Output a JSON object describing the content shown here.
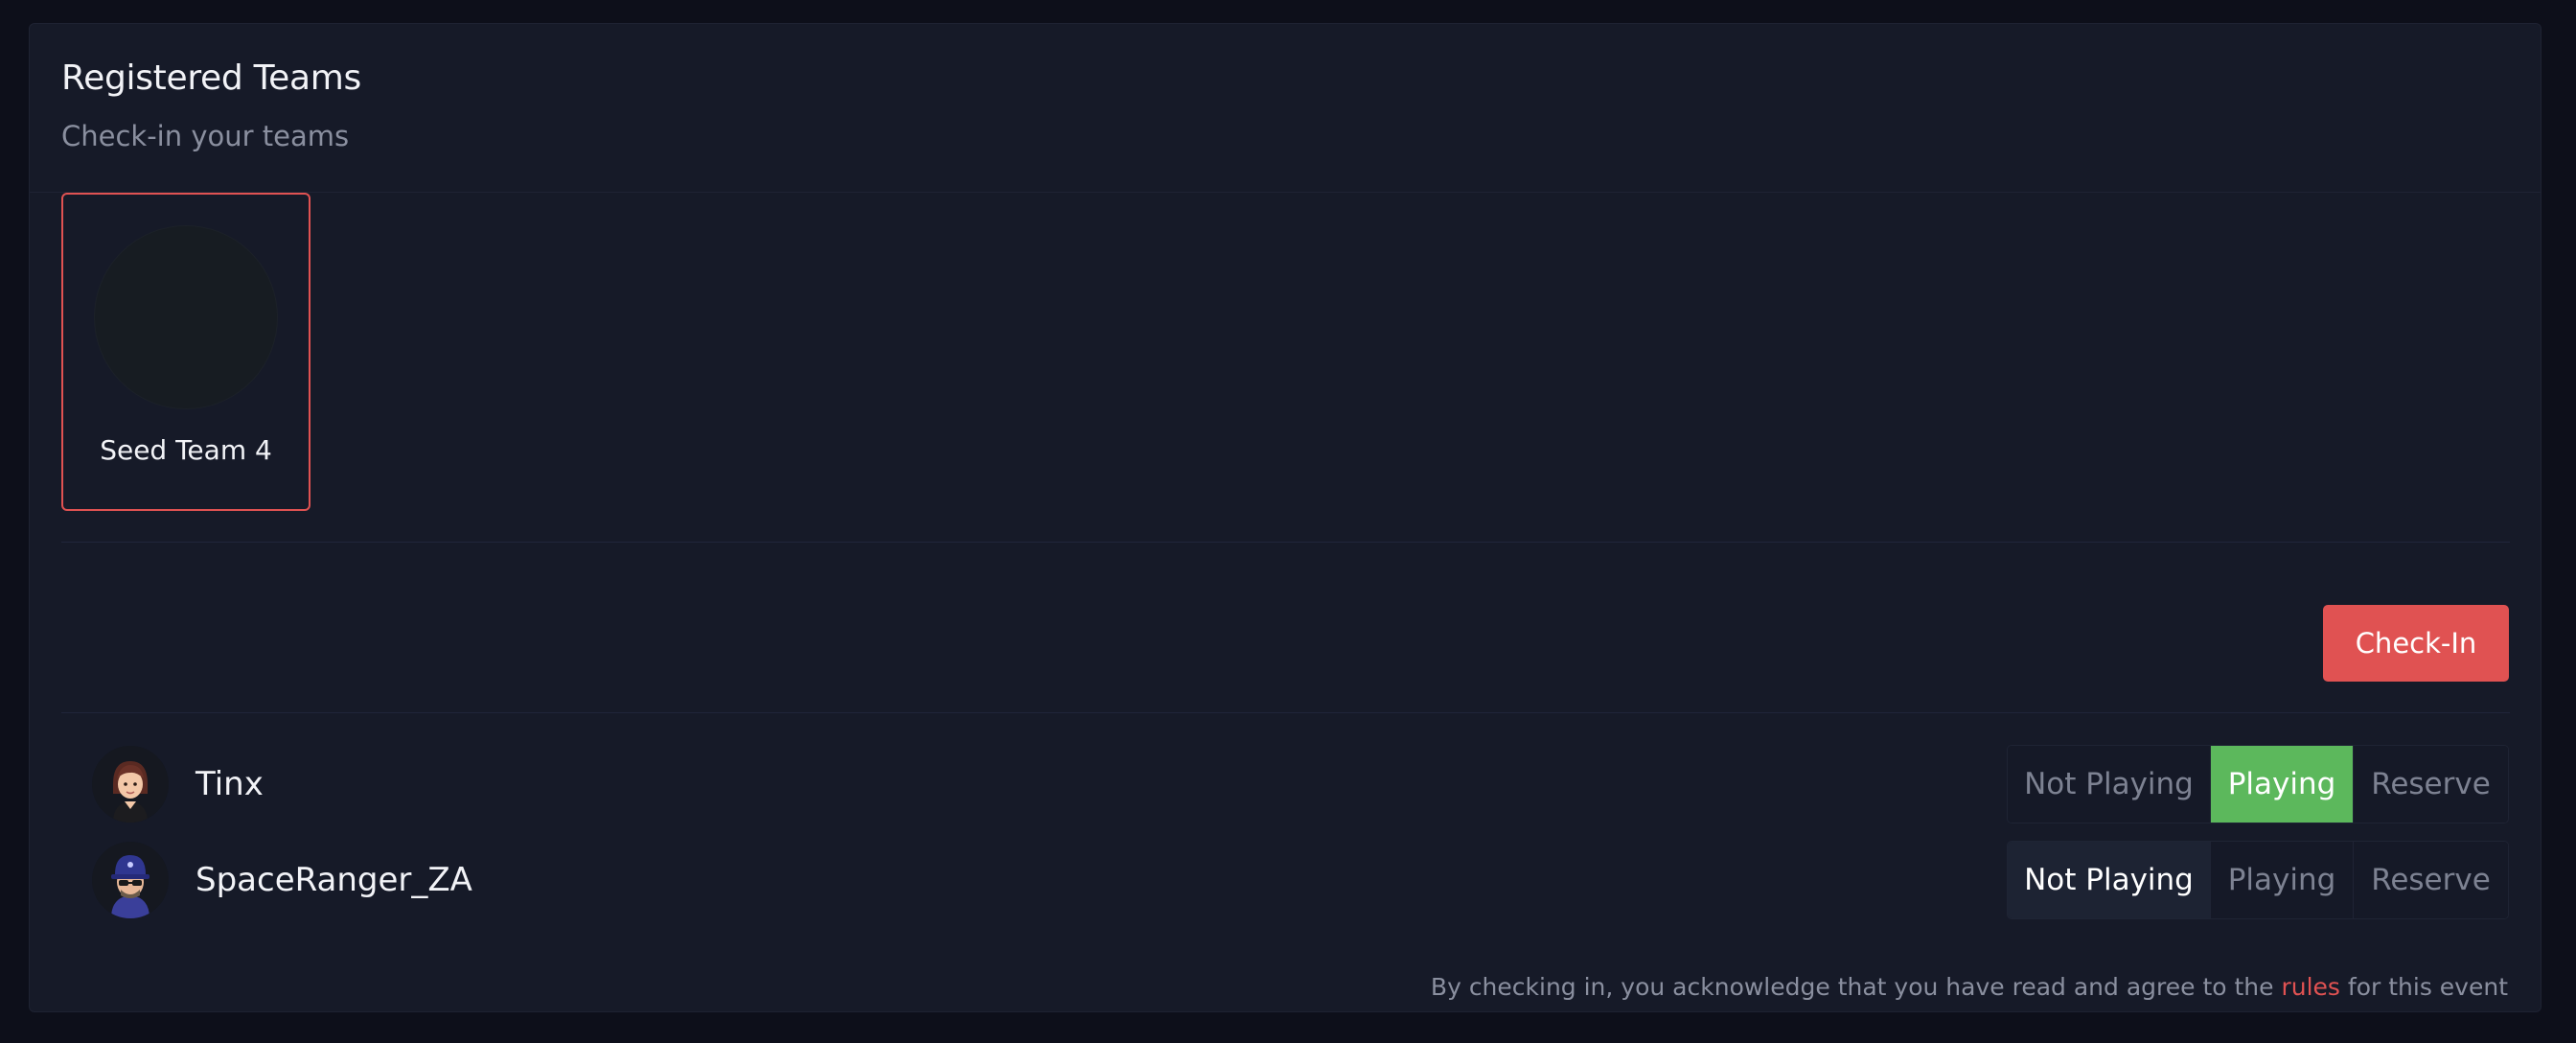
{
  "header": {
    "title": "Registered Teams",
    "subtitle": "Check-in your teams"
  },
  "teams": [
    {
      "name": "Seed Team 4",
      "selected": true
    }
  ],
  "checkin_button": {
    "label": "Check-In"
  },
  "players": [
    {
      "name": "Tinx",
      "options": [
        "Not Playing",
        "Playing",
        "Reserve"
      ],
      "selected": "Playing"
    },
    {
      "name": "SpaceRanger_ZA",
      "options": [
        "Not Playing",
        "Playing",
        "Reserve"
      ],
      "selected": "Not Playing"
    }
  ],
  "footer": {
    "prefix": "By checking in, you acknowledge that you have read and agree to the",
    "link": "rules",
    "suffix": "for this event"
  },
  "colors": {
    "accent": "#e05252",
    "playing": "#5cb85c",
    "background": "#161a28"
  }
}
